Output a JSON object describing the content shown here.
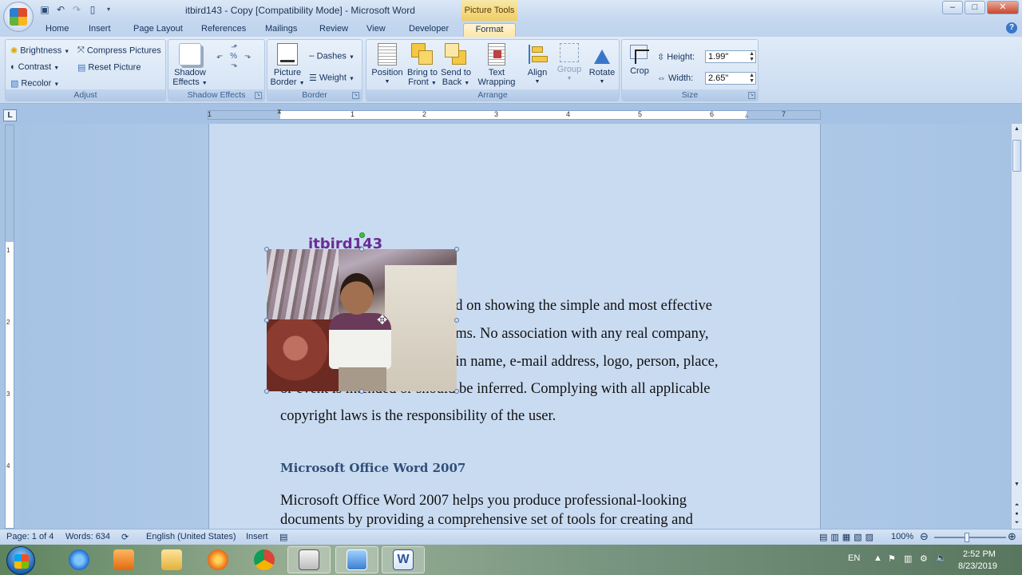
{
  "window": {
    "title": "itbird143 - Copy [Compatibility Mode] - Microsoft Word",
    "context_tab_group": "Picture Tools",
    "controls": [
      "–",
      "□",
      "✕"
    ]
  },
  "tabs": [
    {
      "label": "Home"
    },
    {
      "label": "Insert"
    },
    {
      "label": "Page Layout"
    },
    {
      "label": "References"
    },
    {
      "label": "Mailings"
    },
    {
      "label": "Review"
    },
    {
      "label": "View"
    },
    {
      "label": "Developer"
    },
    {
      "label": "Format",
      "active": true
    }
  ],
  "ribbon": {
    "adjust": {
      "label": "Adjust",
      "brightness": "Brightness",
      "contrast": "Contrast",
      "recolor": "Recolor",
      "compress": "Compress Pictures",
      "reset": "Reset Picture"
    },
    "shadow": {
      "label": "Shadow Effects",
      "shadow_effects_1": "Shadow",
      "shadow_effects_2": "Effects"
    },
    "border": {
      "label": "Border",
      "picture_border_1": "Picture",
      "picture_border_2": "Border",
      "dashes": "Dashes",
      "weight": "Weight"
    },
    "arrange": {
      "label": "Arrange",
      "position": "Position",
      "bring_front_1": "Bring to",
      "bring_front_2": "Front",
      "send_back_1": "Send to",
      "send_back_2": "Back",
      "text_wrap_1": "Text",
      "text_wrap_2": "Wrapping",
      "align": "Align",
      "group": "Group",
      "rotate": "Rotate"
    },
    "size": {
      "label": "Size",
      "crop": "Crop",
      "height_label": "Height:",
      "height_value": "1.99\"",
      "width_label": "Width:",
      "width_value": "2.65\""
    }
  },
  "ruler": {
    "h_numbers": [
      "1",
      "1",
      "2",
      "3",
      "4",
      "5",
      "6",
      "7"
    ],
    "v_numbers": [
      "1",
      "2",
      "3",
      "4"
    ]
  },
  "document": {
    "wordart": "itbird143",
    "lines": [
      "ed on showing the simple and most effective",
      "ems. No association with any real company,",
      "ain name, e-mail address, logo, person, place,",
      "or event is intended or should be inferred. Complying with all applicable",
      "copyright laws is the responsibility of the user."
    ],
    "heading": "Microsoft Office Word 2007",
    "para2": [
      "Microsoft Office Word 2007 helps you produce professional-looking",
      "documents by providing a comprehensive set of tools for creating and"
    ]
  },
  "status": {
    "page": "Page: 1 of 4",
    "words": "Words: 634",
    "language": "English (United States)",
    "mode": "Insert",
    "zoom": "100%"
  },
  "tray": {
    "lang": "EN",
    "time": "2:52 PM",
    "date": "8/23/2019"
  },
  "colors": {
    "accent": "#fde7a6",
    "wordart": "#6a2c95",
    "heading": "#2f4e77"
  }
}
